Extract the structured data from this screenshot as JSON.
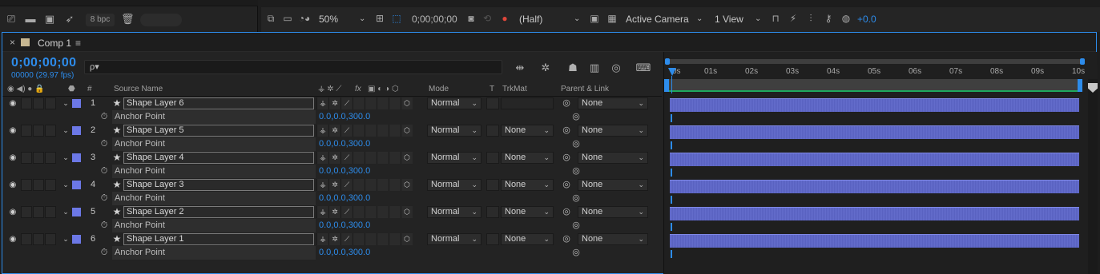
{
  "project_toolbar": {
    "bpc": "8 bpc",
    "icons": [
      "interpret-footage-icon",
      "new-folder-icon",
      "new-composition-icon",
      "flowchart-icon",
      "trash-icon"
    ]
  },
  "viewer_toolbar": {
    "zoom": "50%",
    "timecode": "0;00;00;00",
    "resolution": "(Half)",
    "camera": "Active Camera",
    "views": "1 View",
    "exposure": "+0.0"
  },
  "panel": {
    "tab_close": "×",
    "tab_label": "Comp 1",
    "tab_menu": "≡",
    "timecode": "0;00;00;00",
    "fps": "00000 (29.97 fps)",
    "search_icon": "ρ▾",
    "search_value": ""
  },
  "columns": {
    "hash": "#",
    "source_name": "Source Name",
    "fx": "fx",
    "mode": "Mode",
    "t": "T",
    "trkmat": "TrkMat",
    "parent_link": "Parent & Link"
  },
  "layers": [
    {
      "num": "1",
      "name": "Shape Layer 6",
      "mode": "Normal",
      "trkmat": "",
      "parent": "None",
      "prop_name": "Anchor Point",
      "prop_value": "0.0,0.0,300.0"
    },
    {
      "num": "2",
      "name": "Shape Layer 5",
      "mode": "Normal",
      "trkmat": "None",
      "parent": "None",
      "prop_name": "Anchor Point",
      "prop_value": "0.0,0.0,300.0"
    },
    {
      "num": "3",
      "name": "Shape Layer 4",
      "mode": "Normal",
      "trkmat": "None",
      "parent": "None",
      "prop_name": "Anchor Point",
      "prop_value": "0.0,0.0,300.0"
    },
    {
      "num": "4",
      "name": "Shape Layer 3",
      "mode": "Normal",
      "trkmat": "None",
      "parent": "None",
      "prop_name": "Anchor Point",
      "prop_value": "0.0,0.0,300.0"
    },
    {
      "num": "5",
      "name": "Shape Layer 2",
      "mode": "Normal",
      "trkmat": "None",
      "parent": "None",
      "prop_name": "Anchor Point",
      "prop_value": "0.0,0.0,300.0"
    },
    {
      "num": "6",
      "name": "Shape Layer 1",
      "mode": "Normal",
      "trkmat": "None",
      "parent": "None",
      "prop_name": "Anchor Point",
      "prop_value": "0.0,0.0,300.0"
    }
  ],
  "timeline": {
    "ruler": [
      "0s",
      "01s",
      "02s",
      "03s",
      "04s",
      "05s",
      "06s",
      "07s",
      "08s",
      "09s",
      "10s"
    ]
  },
  "colors": {
    "accent": "#2d8ceb",
    "layer_label": "#6c78e6",
    "layer_bar": "#5d66c9",
    "work_area": "#1fa85f"
  }
}
